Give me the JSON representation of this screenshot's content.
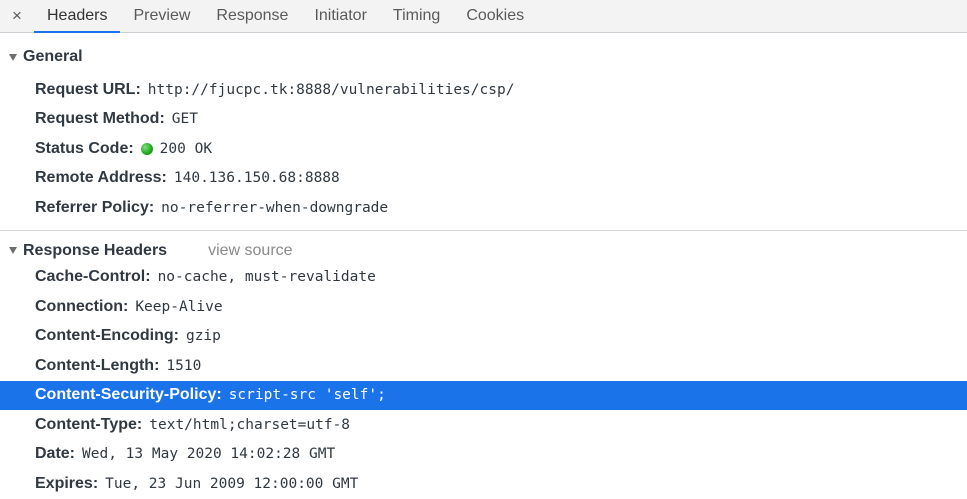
{
  "tabs": [
    {
      "label": "Headers",
      "active": true
    },
    {
      "label": "Preview"
    },
    {
      "label": "Response"
    },
    {
      "label": "Initiator"
    },
    {
      "label": "Timing"
    },
    {
      "label": "Cookies"
    }
  ],
  "close_icon": "×",
  "general": {
    "title": "General",
    "rows": [
      {
        "name": "Request URL:",
        "value": "http://fjucpc.tk:8888/vulnerabilities/csp/"
      },
      {
        "name": "Request Method:",
        "value": "GET"
      },
      {
        "name": "Status Code:",
        "value": "200 OK",
        "status_color": "#1fa51f"
      },
      {
        "name": "Remote Address:",
        "value": "140.136.150.68:8888"
      },
      {
        "name": "Referrer Policy:",
        "value": "no-referrer-when-downgrade"
      }
    ]
  },
  "response": {
    "title": "Response Headers",
    "view_source": "view source",
    "rows": [
      {
        "name": "Cache-Control:",
        "value": "no-cache, must-revalidate"
      },
      {
        "name": "Connection:",
        "value": "Keep-Alive"
      },
      {
        "name": "Content-Encoding:",
        "value": "gzip"
      },
      {
        "name": "Content-Length:",
        "value": "1510"
      },
      {
        "name": "Content-Security-Policy:",
        "value": "script-src 'self';",
        "selected": true
      },
      {
        "name": "Content-Type:",
        "value": "text/html;charset=utf-8"
      },
      {
        "name": "Date:",
        "value": "Wed, 13 May 2020 14:02:28 GMT"
      },
      {
        "name": "Expires:",
        "value": "Tue, 23 Jun 2009 12:00:00 GMT"
      }
    ]
  },
  "colors": {
    "accent": "#1a73e8",
    "status_ok": "#1fa51f"
  }
}
